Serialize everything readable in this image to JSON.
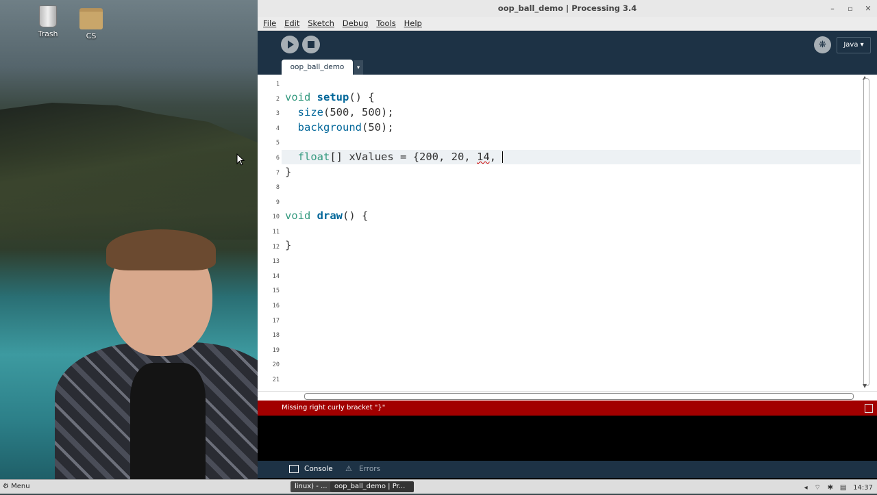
{
  "desktop": {
    "icons": [
      {
        "label": "Trash",
        "icon": "trash-icon"
      },
      {
        "label": "CS",
        "icon": "folder-icon"
      }
    ]
  },
  "window": {
    "title": "oop_ball_demo | Processing 3.4",
    "controls": {
      "minimize": "–",
      "maximize": "▫",
      "close": "✕"
    },
    "menu": [
      "File",
      "Edit",
      "Sketch",
      "Debug",
      "Tools",
      "Help"
    ],
    "toolbar": {
      "run_icon": "play-icon",
      "stop_icon": "stop-icon",
      "mode_icon": "debug-butterfly-icon",
      "mode_label": "Java ▾"
    },
    "tab": {
      "label": "oop_ball_demo",
      "menu": "▾"
    },
    "editor": {
      "line_numbers": [
        "1",
        "2",
        "3",
        "4",
        "5",
        "6",
        "7",
        "8",
        "9",
        "10",
        "11",
        "12",
        "13",
        "14",
        "15",
        "16",
        "17",
        "18",
        "19",
        "20",
        "21"
      ],
      "current_line": 6,
      "code": {
        "l2_kw": "void",
        "l2_fn": "setup",
        "l2_rest": "() {",
        "l3_fn": "size",
        "l3_rest": "(500, 500);",
        "l4_fn": "background",
        "l4_rest": "(50);",
        "l6_kw": "float",
        "l6_rest": "[] xValues = {200, 20, ",
        "l6_err": "14",
        "l6_tail": ", ",
        "l7": "}",
        "l10_kw": "void",
        "l10_fn": "draw",
        "l10_rest": "() {",
        "l12": "}"
      }
    },
    "status": {
      "message": "Missing right curly bracket \"}\"",
      "color": "#a20000"
    },
    "console_tabs": [
      {
        "label": "Console",
        "icon": "console-icon"
      },
      {
        "label": "Errors",
        "icon": "warning-icon"
      }
    ]
  },
  "taskbar": {
    "menu_label": "Menu",
    "tasks": [
      "linux) - ...",
      "oop_ball_demo | Pr..."
    ],
    "clock": "14:37"
  },
  "colors": {
    "toolbar_bg": "#1d3245",
    "keyword": "#33997e",
    "function": "#006699",
    "error_bar": "#a20000"
  }
}
